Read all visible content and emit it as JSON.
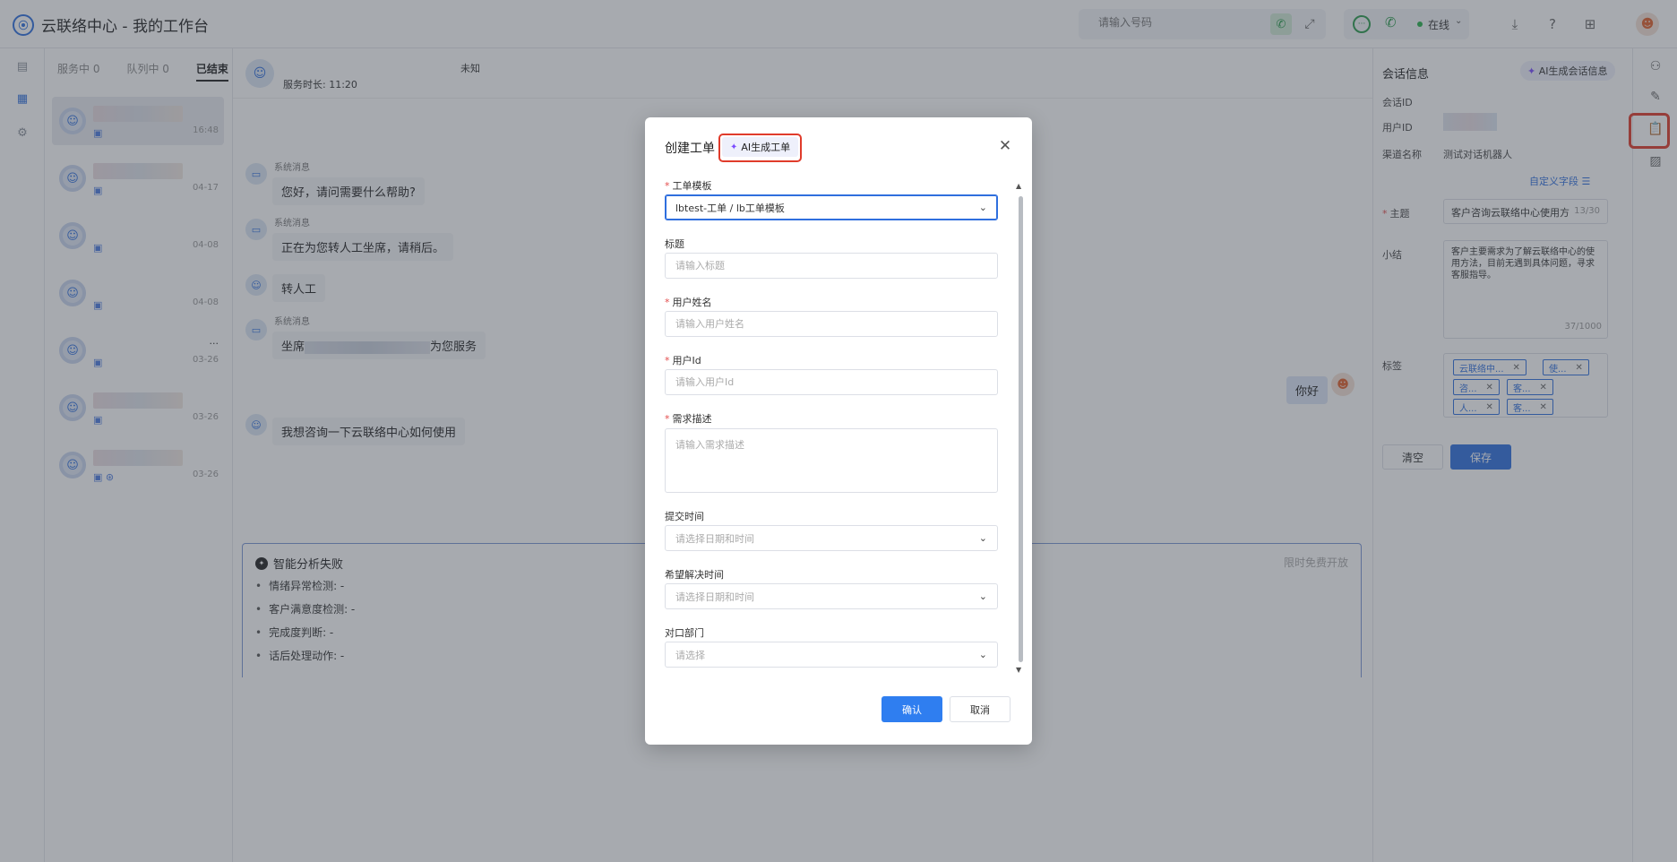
{
  "app": {
    "title": "云联络中心 - 我的工作台",
    "logo_glyph": "⦿"
  },
  "topbar": {
    "dial_placeholder": "请输入号码",
    "status": "在线",
    "icons": [
      "phone-icon",
      "expand-icon",
      "chat-icon",
      "call-icon",
      "download-icon",
      "help-icon",
      "grid-icon",
      "user-avatar"
    ]
  },
  "sessions": {
    "tabs": [
      "服务中 0",
      "队列中 0",
      "已结束"
    ],
    "active_tab": "已结束",
    "items": [
      {
        "time": "16:48"
      },
      {
        "time": "04-17"
      },
      {
        "time": "04-08"
      },
      {
        "time": "04-08"
      },
      {
        "time": "03-26",
        "extra": "..."
      },
      {
        "time": "03-26"
      },
      {
        "time": "03-26"
      }
    ]
  },
  "chat": {
    "duration": "服务时长: 11:20",
    "unknown": "未知",
    "messages": [
      {
        "label": "系统消息",
        "text": "您好，请问需要什么帮助?"
      },
      {
        "label": "系统消息",
        "text": "正在为您转人工坐席，请稍后。"
      },
      {
        "label": "",
        "text": "转人工"
      },
      {
        "label": "系统消息",
        "text_a": "坐席",
        "text_b": "为您服务"
      },
      {
        "label": "",
        "text": "我想咨询一下云联络中心如何使用"
      }
    ],
    "agent_reply": "你好",
    "analysis": {
      "title": "智能分析失败",
      "tag": "限时免费开放",
      "items": [
        "情绪异常检测: -",
        "客户满意度检测: -",
        "完成度判断: -",
        "话后处理动作: -"
      ]
    }
  },
  "info": {
    "title": "会话信息",
    "ai_button": "AI生成会话信息",
    "session_id_label": "会话ID",
    "user_id_label": "用户ID",
    "channel_label": "渠道名称",
    "channel_value": "测试对话机器人",
    "custom_fields": "自定义字段",
    "subject_label": "主题",
    "subject_value": "客户咨询云联络中心使用方",
    "subject_count": "13/30",
    "summary_label": "小结",
    "summary_value": "客户主要需求为了解云联络中心的使用方法，目前无遇到具体问题，寻求客服指导。",
    "summary_count": "37/1000",
    "tags_label": "标签",
    "tags": [
      "云联络中...",
      "使...",
      "咨...",
      "客...",
      "人...",
      "客..."
    ],
    "clear_button": "清空",
    "save_button": "保存"
  },
  "modal": {
    "title": "创建工单",
    "ai_button": "AI生成工单",
    "fields": {
      "template_label": "工单模板",
      "template_value": "lbtest-工单 / lb工单模板",
      "title_label": "标题",
      "title_placeholder": "请输入标题",
      "username_label": "用户姓名",
      "username_placeholder": "请输入用户姓名",
      "userid_label": "用户Id",
      "userid_placeholder": "请输入用户Id",
      "desc_label": "需求描述",
      "desc_placeholder": "请输入需求描述",
      "submit_time_label": "提交时间",
      "submit_time_placeholder": "请选择日期和时间",
      "expect_time_label": "希望解决时间",
      "expect_time_placeholder": "请选择日期和时间",
      "dept_label": "对口部门",
      "dept_placeholder": "请选择"
    },
    "confirm": "确认",
    "cancel": "取消"
  },
  "colors": {
    "primary": "#2f6fde",
    "highlight": "#e03b2b",
    "online": "#27b14b"
  }
}
